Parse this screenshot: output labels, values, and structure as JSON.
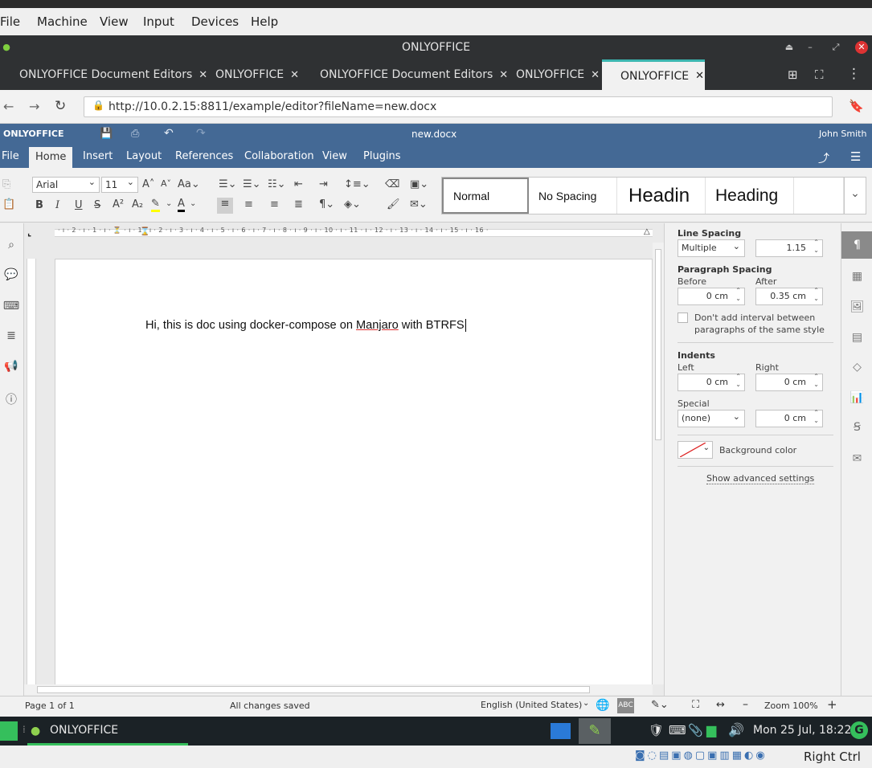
{
  "vbox_menu": [
    "File",
    "Machine",
    "View",
    "Input",
    "Devices",
    "Help"
  ],
  "window": {
    "title": "ONLYOFFICE"
  },
  "browser_tabs": [
    {
      "label": "ONLYOFFICE Document Editors",
      "active": false
    },
    {
      "label": "ONLYOFFICE",
      "active": false
    },
    {
      "label": "ONLYOFFICE Document Editors",
      "active": false
    },
    {
      "label": "ONLYOFFICE",
      "active": false
    },
    {
      "label": "ONLYOFFICE",
      "active": true
    }
  ],
  "tab_close_glyph": "✕",
  "address": {
    "url": "http://10.0.2.15:8811/example/editor?fileName=new.docx"
  },
  "app": {
    "logo": "ONLYOFFICE",
    "filename": "new.docx",
    "user": "John Smith"
  },
  "menu_tabs": [
    "File",
    "Home",
    "Insert",
    "Layout",
    "References",
    "Collaboration",
    "View",
    "Plugins"
  ],
  "active_menu_tab": "Home",
  "toolbar": {
    "font_name": "Arial",
    "font_size": "11"
  },
  "styles": [
    "Normal",
    "No Spacing",
    "Headin",
    "Heading",
    ""
  ],
  "ruler_h": "· ı · 2 · ı · 1 · ı · ⏳ · ı · 1 · ı · 2 · ı · 3 · ı · 4 · ı · 5 · ı · 6 · ı · 7 · ı · 8 · ı · 9 · ı · 10 · ı · 11 · ı · 12 · ı · 13 · ı · 14 · ı · 15 · ı · 16 ·",
  "document": {
    "text_before": "Hi, this is doc using docker-compose on ",
    "text_spell": "Manjaro",
    "text_after": " with BTRFS"
  },
  "paragraph_settings": {
    "line_spacing_title": "Line Spacing",
    "line_spacing_mode": "Multiple",
    "line_spacing_value": "1.15",
    "paragraph_spacing_title": "Paragraph Spacing",
    "before_label": "Before",
    "before_value": "0 cm",
    "after_label": "After",
    "after_value": "0.35 cm",
    "dont_add_interval_label": "Don't add interval between paragraphs of the same style",
    "indents_title": "Indents",
    "left_label": "Left",
    "left_value": "0 cm",
    "right_label": "Right",
    "right_value": "0 cm",
    "special_label": "Special",
    "special_mode": "(none)",
    "special_value": "0 cm",
    "background_color_label": "Background color",
    "advanced_link": "Show advanced settings"
  },
  "status": {
    "page": "Page 1 of 1",
    "saved": "All changes saved",
    "language": "English (United States)",
    "zoom": "Zoom 100%"
  },
  "taskbar": {
    "app": "ONLYOFFICE",
    "clock": "Mon 25 Jul, 18:22"
  },
  "vbox_status": {
    "host_key": "Right Ctrl"
  },
  "colors": {
    "header_blue": "#446995",
    "dark_chrome": "#2f3133",
    "taskbar": "#1b2226",
    "tab_accent": "#3cb6b0"
  }
}
